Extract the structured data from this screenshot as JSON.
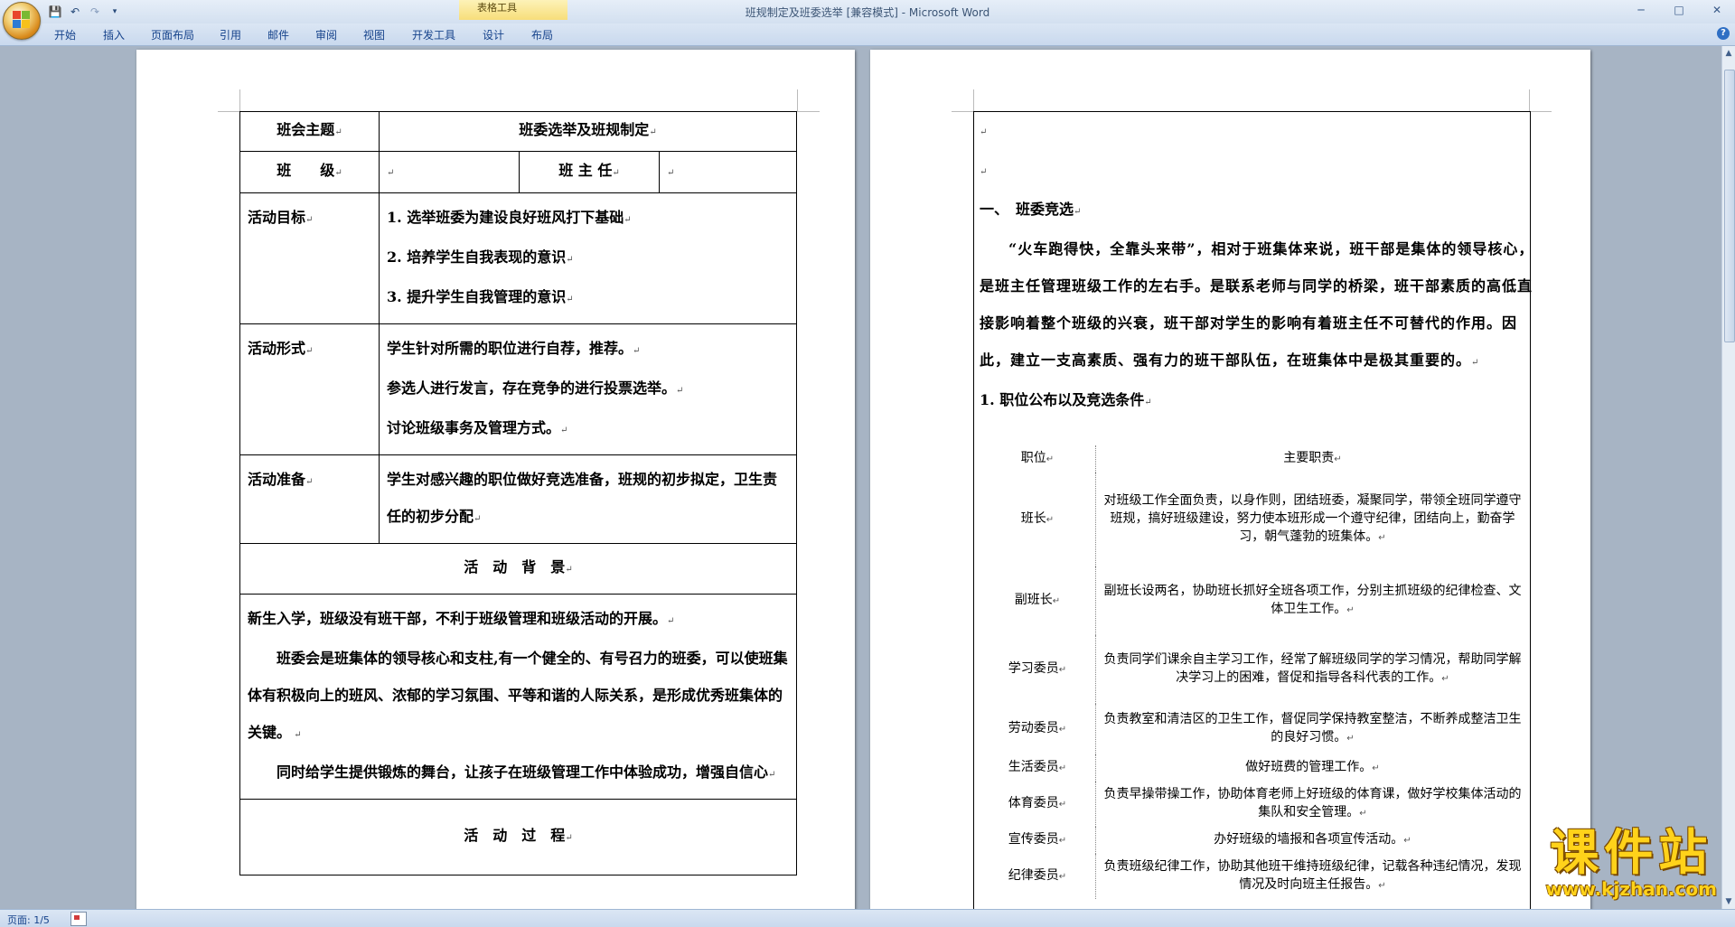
{
  "window": {
    "title_doc": "班规制定及班委选举 [兼容模式] - ",
    "title_app": "Microsoft Word",
    "contextual_tab_group": "表格工具"
  },
  "ribbon": {
    "tabs": [
      "开始",
      "插入",
      "页面布局",
      "引用",
      "邮件",
      "审阅",
      "视图",
      "开发工具",
      "设计",
      "布局"
    ]
  },
  "page1": {
    "row_theme": {
      "label": "班会主题",
      "value": "班委选举及班规制定"
    },
    "row_class": {
      "label": "班　　级",
      "teacher_label": "班 主 任"
    },
    "goals": {
      "label": "活动目标",
      "items": [
        "1. 选举班委为建设良好班风打下基础",
        "2. 培养学生自我表现的意识",
        "3. 提升学生自我管理的意识"
      ]
    },
    "forms": {
      "label": "活动形式",
      "items": [
        "学生针对所需的职位进行自荐，推荐。",
        "参选人进行发言，存在竞争的进行投票选举。",
        "讨论班级事务及管理方式。"
      ]
    },
    "prep": {
      "label": "活动准备",
      "text": "学生对感兴趣的职位做好竞选准备，班规的初步拟定，卫生责任的初步分配"
    },
    "background_heading": "活　动　背　景",
    "background_paras": [
      "新生入学，班级没有班干部，不利于班级管理和班级活动的开展。",
      "班委会是班集体的领导核心和支柱,有一个健全的、有号召力的班委，可以使班集体有积极向上的班风、浓郁的学习氛围、平等和谐的人际关系，是形成优秀班集体的关键。",
      "同时给学生提供锻炼的舞台，让孩子在班级管理工作中体验成功，增强自信心"
    ],
    "process_heading": "活　动　过　程"
  },
  "page2": {
    "section_title": "一、　班委竞选",
    "intro": "“火车跑得快，全靠头来带”，相对于班集体来说，班干部是集体的领导核心，是班主任管理班级工作的左右手。是联系老师与同学的桥梁，班干部素质的高低直接影响着整个班级的兴衰，班干部对学生的影响有着班主任不可替代的作用。因此，建立一支高素质、强有力的班干部队伍，在班集体中是极其重要的。",
    "subsection": "1. 职位公布以及竞选条件",
    "table_header": {
      "role": "职位",
      "duty": "主要职责"
    },
    "roles": [
      {
        "name": "班长",
        "duty": "对班级工作全面负责，以身作则，团结班委，凝聚同学，带领全班同学遵守班规，搞好班级建设，努力使本班形成一个遵守纪律，团结向上，勤奋学习，朝气蓬勃的班集体。"
      },
      {
        "name": "副班长",
        "duty": "副班长设两名，协助班长抓好全班各项工作，分别主抓班级的纪律检查、文体卫生工作。"
      },
      {
        "name": "学习委员",
        "duty": "负责同学们课余自主学习工作，经常了解班级同学的学习情况，帮助同学解决学习上的困难，督促和指导各科代表的工作。"
      },
      {
        "name": "劳动委员",
        "duty": "负责教室和清洁区的卫生工作，督促同学保持教室整洁，不断养成整洁卫生的良好习惯。"
      },
      {
        "name": "生活委员",
        "duty": "做好班费的管理工作。"
      },
      {
        "name": "体育委员",
        "duty": "负责早操带操工作，协助体育老师上好班级的体育课，做好学校集体活动的集队和安全管理。"
      },
      {
        "name": "宣传委员",
        "duty": "办好班级的墙报和各项宣传活动。"
      },
      {
        "name": "纪律委员",
        "duty": "负责班级纪律工作，协助其他班干维持班级纪律，记载各种违纪情况，发现情况及时向班主任报告。"
      }
    ]
  },
  "watermark": {
    "title": "课件站",
    "url": "www.kjzhan.com"
  },
  "status": {
    "page_info": "页面: 1/5"
  },
  "colors": {
    "ribbon_text": "#15428b",
    "workspace": "#a7b4c4",
    "watermark": "#ffd21a"
  },
  "icons": [
    "office-button-icon",
    "save-icon",
    "undo-icon",
    "redo-icon",
    "customize-qat-icon",
    "help-icon",
    "minimize-icon",
    "maximize-icon",
    "close-icon"
  ]
}
